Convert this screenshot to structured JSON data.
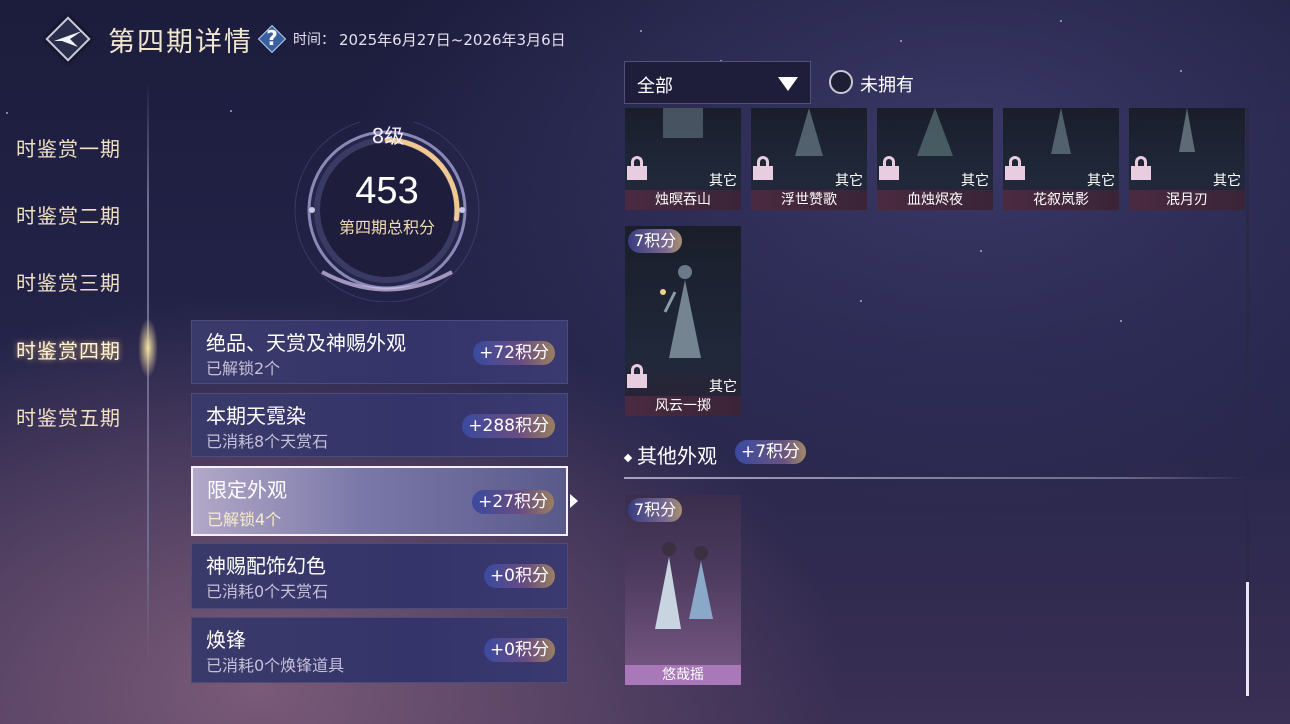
{
  "header": {
    "title": "第四期详情",
    "help_label": "?",
    "time_label": "时间：",
    "time_value": "2025年6月27日~2026年3月6日"
  },
  "sidebar": {
    "items": [
      {
        "label": "时鉴赏一期"
      },
      {
        "label": "时鉴赏二期"
      },
      {
        "label": "时鉴赏三期"
      },
      {
        "label": "时鉴赏四期",
        "active": true
      },
      {
        "label": "时鉴赏五期"
      }
    ]
  },
  "progress": {
    "level": "8级",
    "score": "453",
    "score_label": "第四期总积分",
    "ring_fill": 0.27
  },
  "categories": [
    {
      "title": "绝品、天赏及神赐外观",
      "sub": "已解锁2个",
      "points": "+72积分"
    },
    {
      "title": "本期天霓染",
      "sub": "已消耗8个天赏石",
      "points": "+288积分"
    },
    {
      "title": "限定外观",
      "sub": "已解锁4个",
      "points": "+27积分",
      "selected": true
    },
    {
      "title": "神赐配饰幻色",
      "sub": "已消耗0个天赏石",
      "points": "+0积分"
    },
    {
      "title": "焕锋",
      "sub": "已消耗0个焕锋道具",
      "points": "+0积分"
    }
  ],
  "filter": {
    "dropdown_value": "全部",
    "checkbox_label": "未拥有"
  },
  "items_top_row": [
    {
      "name": "烛暝吞山",
      "tag": "其它"
    },
    {
      "name": "浮世赞歌",
      "tag": "其它"
    },
    {
      "name": "血烛烬夜",
      "tag": "其它"
    },
    {
      "name": "花叙岚影",
      "tag": "其它"
    },
    {
      "name": "泯月刃",
      "tag": "其它"
    }
  ],
  "item_single": {
    "name": "风云一掷",
    "tag": "其它",
    "points": "7积分"
  },
  "other_section": {
    "title": "其他外观",
    "points": "+7积分",
    "item": {
      "name": "悠哉摇",
      "points": "7积分"
    }
  },
  "colors": {
    "accent_gold": "#f0dcb0",
    "selected_card": "#b2a8c8",
    "lock": "#e8cce0"
  }
}
